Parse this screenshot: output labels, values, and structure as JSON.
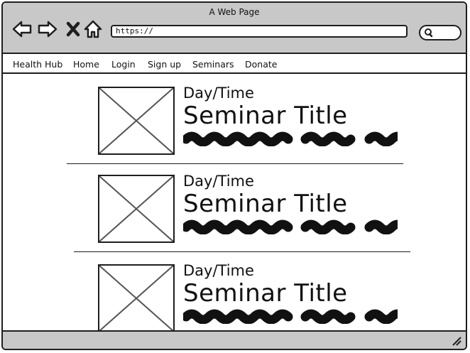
{
  "window": {
    "title": "A Web Page"
  },
  "browser": {
    "url": "https://",
    "back_icon": "arrow-left-icon",
    "forward_icon": "arrow-right-icon",
    "stop_icon": "close-icon",
    "home_icon": "home-icon",
    "search_icon": "search-icon"
  },
  "nav": {
    "items": [
      {
        "label": "Health Hub"
      },
      {
        "label": "Home"
      },
      {
        "label": "Login"
      },
      {
        "label": "Sign up"
      },
      {
        "label": "Seminars"
      },
      {
        "label": "Donate"
      }
    ]
  },
  "seminars": [
    {
      "daytime": "Day/Time",
      "title": "Seminar Title",
      "image_icon": "image-placeholder-icon"
    },
    {
      "daytime": "Day/Time",
      "title": "Seminar Title",
      "image_icon": "image-placeholder-icon"
    },
    {
      "daytime": "Day/Time",
      "title": "Seminar Title",
      "image_icon": "image-placeholder-icon"
    }
  ],
  "colors": {
    "chrome": "#c8c8c8",
    "ink": "#1e1e1e",
    "page": "#ffffff"
  }
}
